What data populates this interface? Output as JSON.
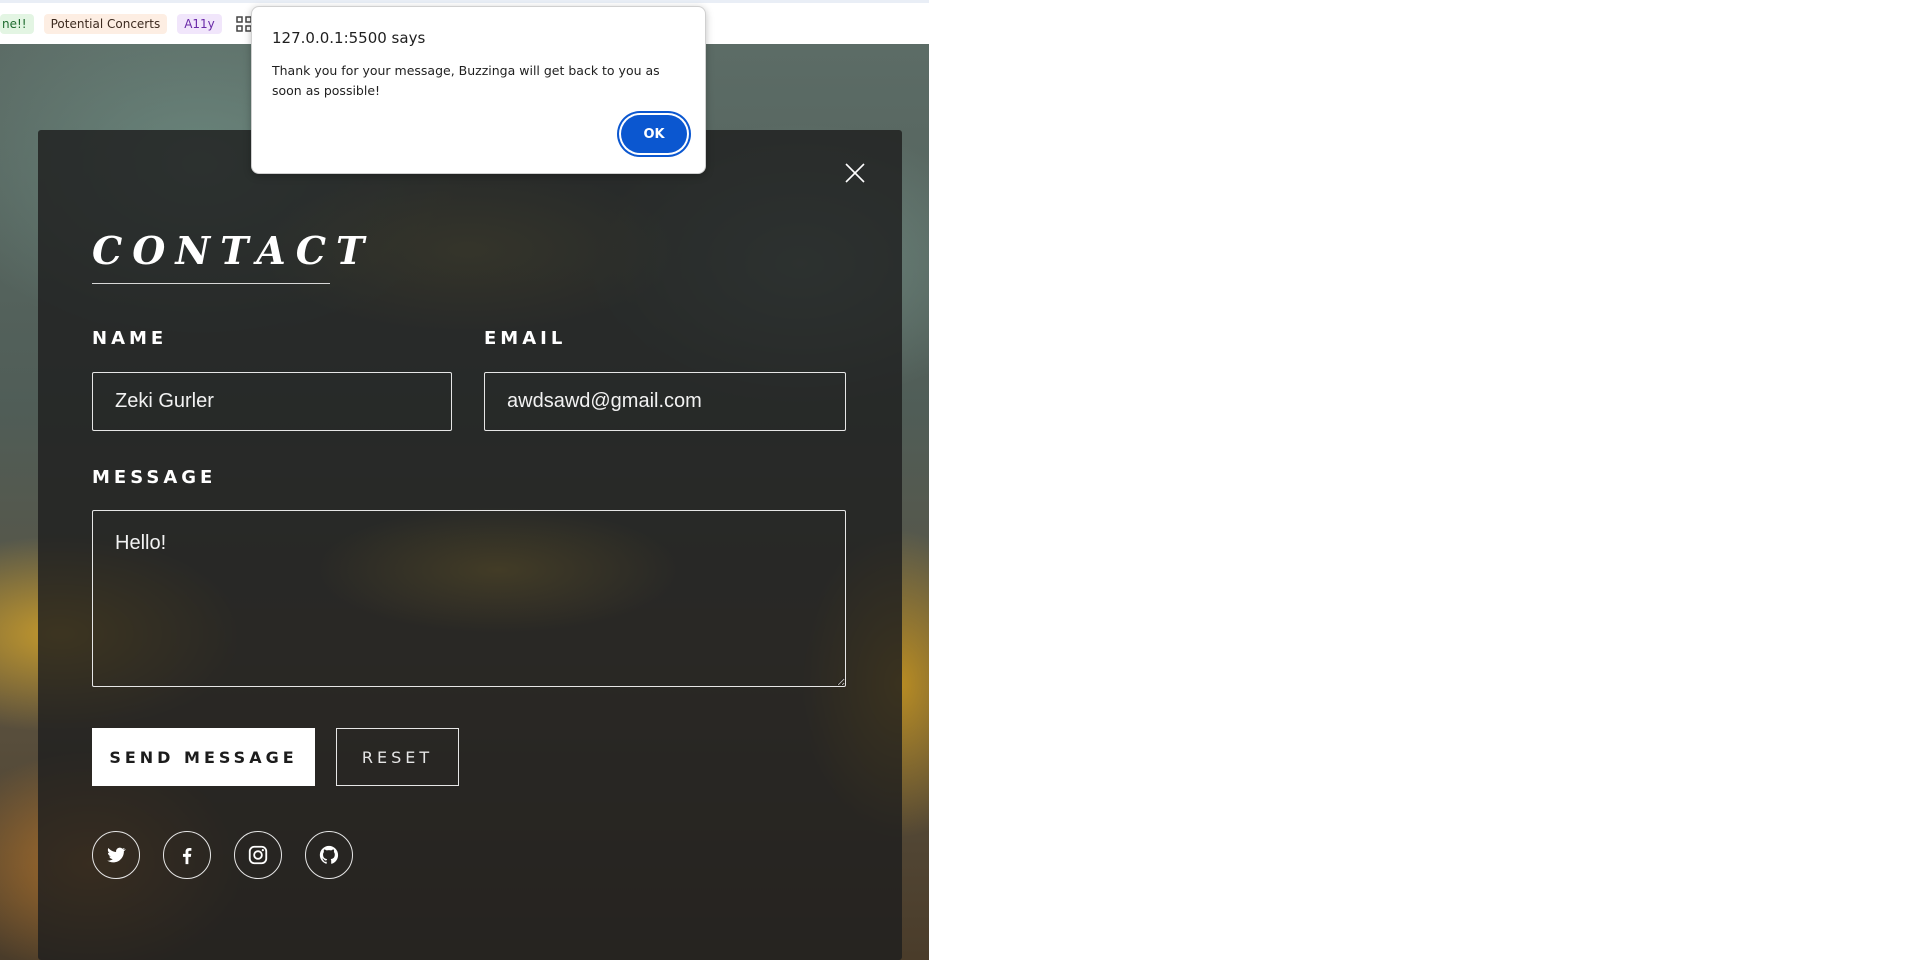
{
  "bookmarks": {
    "items": [
      {
        "label": "ne!!",
        "color": "green"
      },
      {
        "label": "Potential Concerts",
        "color": "orange"
      },
      {
        "label": "A11y",
        "color": "purple"
      }
    ],
    "apps_icon": "apps-grid-icon"
  },
  "contact": {
    "title": "CONTACT",
    "name_label": "NAME",
    "email_label": "EMAIL",
    "message_label": "MESSAGE",
    "name_value": "Zeki Gurler",
    "email_value": "awdsawd@gmail.com",
    "message_value": "Hello!",
    "send_label": "SEND MESSAGE",
    "reset_label": "RESET",
    "close_icon": "close-icon",
    "social": [
      "twitter-icon",
      "facebook-icon",
      "instagram-icon",
      "github-icon"
    ]
  },
  "dialog": {
    "title": "127.0.0.1:5500 says",
    "message": "Thank you for your message, Buzzinga will get back to you as soon as possible!",
    "ok_label": "OK"
  },
  "colors": {
    "accent": "#0b57d0",
    "panel": "#1e1e1e"
  }
}
